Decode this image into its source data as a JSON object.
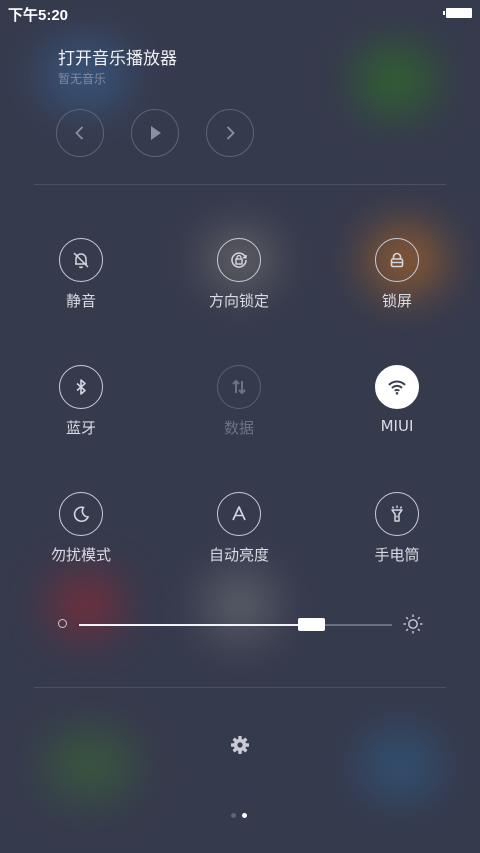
{
  "status_bar": {
    "time": "下午5:20"
  },
  "music_player": {
    "title": "打开音乐播放器",
    "subtitle": "暂无音乐",
    "controls": [
      "previous-icon",
      "play-icon",
      "next-icon"
    ]
  },
  "toggles": [
    {
      "id": "mute",
      "label": "静音",
      "icon": "bell-mute-icon",
      "state": "off"
    },
    {
      "id": "rotation-lock",
      "label": "方向锁定",
      "icon": "rotation-lock-icon",
      "state": "off"
    },
    {
      "id": "lock-screen",
      "label": "锁屏",
      "icon": "lock-icon",
      "state": "off"
    },
    {
      "id": "bluetooth",
      "label": "蓝牙",
      "icon": "bluetooth-icon",
      "state": "off"
    },
    {
      "id": "data",
      "label": "数据",
      "icon": "mobile-data-icon",
      "state": "disabled"
    },
    {
      "id": "wifi",
      "label": "MIUI",
      "icon": "wifi-icon",
      "state": "on"
    },
    {
      "id": "dnd",
      "label": "勿扰模式",
      "icon": "moon-icon",
      "state": "off"
    },
    {
      "id": "auto-brightness",
      "label": "自动亮度",
      "icon": "auto-brightness-icon",
      "state": "off"
    },
    {
      "id": "flashlight",
      "label": "手电筒",
      "icon": "flashlight-icon",
      "state": "off"
    }
  ],
  "brightness": {
    "level": 0.74
  },
  "pager": {
    "pages": 2,
    "current": 2
  },
  "colors": {
    "background": "#363a4d",
    "active_tile": "#ffffff",
    "inactive": "#c9ccd6",
    "disabled": "#5a6074"
  }
}
